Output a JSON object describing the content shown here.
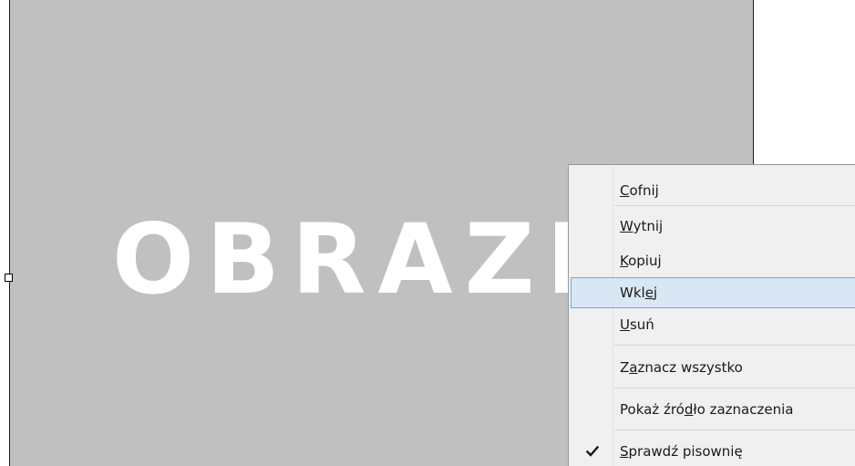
{
  "canvas": {
    "placeholder_text": "OBRAZE"
  },
  "context_menu": {
    "items": [
      {
        "id": "undo",
        "before": "",
        "key": "C",
        "after": "ofnij"
      },
      {
        "id": "cut",
        "before": "",
        "key": "W",
        "after": "ytnij"
      },
      {
        "id": "copy",
        "before": "",
        "key": "K",
        "after": "opiuj"
      },
      {
        "id": "paste",
        "before": "Wkl",
        "key": "e",
        "after": "j"
      },
      {
        "id": "delete",
        "before": "",
        "key": "U",
        "after": "suń"
      },
      {
        "id": "select-all",
        "before": "Z",
        "key": "a",
        "after": "znacz wszystko"
      },
      {
        "id": "view-selection-source",
        "before": "Pokaż źró",
        "key": "d",
        "after": "ło zaznaczenia"
      },
      {
        "id": "check-spelling",
        "before": "",
        "key": "S",
        "after": "prawdź pisownię",
        "checked": true
      }
    ],
    "highlighted": "paste",
    "colors": {
      "background": "#f0f0f0",
      "highlight_fill": "#d9e7f4",
      "highlight_border": "#7ca7d4",
      "check": "#1a1a1a"
    }
  },
  "icons": {
    "check": "check-icon"
  }
}
